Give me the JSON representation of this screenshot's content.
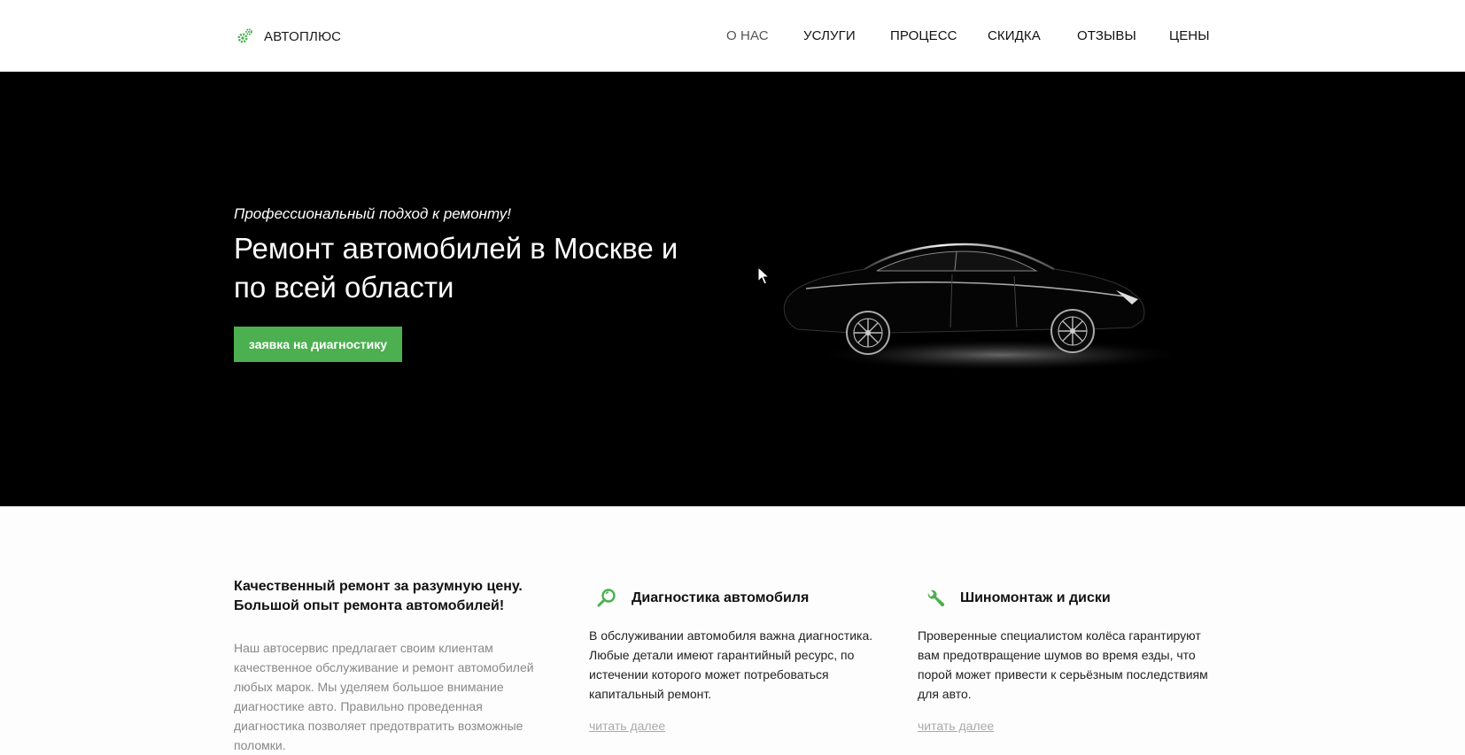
{
  "header": {
    "logo_text": "АВТОПЛЮС",
    "nav": [
      "О НАС",
      "УСЛУГИ",
      "ПРОЦЕСС",
      "СКИДКА",
      "ОТЗЫВЫ",
      "ЦЕНЫ"
    ],
    "active_nav": "О НАС"
  },
  "hero": {
    "tagline": "Профессиональный подход к ремонту!",
    "title": "Ремонт автомобилей в Москве и по всей области",
    "cta_label": "заявка на диагностику",
    "image": "car-silhouette"
  },
  "intro": {
    "title": "Качественный ремонт за разумную цену. Большой опыт ремонта автомобилей!",
    "text": "Наш автосервис предлагает своим клиентам качественное  обслуживание и ремонт автомобилей любых марок. Мы уделяем большое внимание диагностике авто. Правильно проведенная диагностика позволяет предотвратить возможные поломки."
  },
  "features": [
    {
      "icon": "magnifier-icon",
      "title": "Диагностика автомобиля",
      "text": "В обслуживании автомобиля важна диагностика. Любые детали имеют гарантийный ресурс, по истечении которого может потребоваться капитальный ремонт.",
      "link": "читать далее"
    },
    {
      "icon": "wrench-icon",
      "title": "Шиномонтаж и диски",
      "text": "Проверенные специалистом колёса гарантируют вам предотвращение шумов во время езды, что порой может привести к серьёзным последствиям для авто.",
      "link": "читать далее"
    }
  ],
  "colors": {
    "accent": "#4caf50",
    "hero_bg": "#000000",
    "link": "#aaaaaa"
  }
}
